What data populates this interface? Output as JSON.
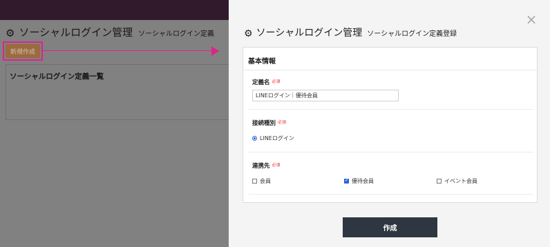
{
  "background": {
    "title": "ソーシャルログイン管理",
    "subtitle": "ソーシャルログイン定義",
    "new_button": "新規作成",
    "list_title": "ソーシャルログイン定義一覧",
    "icon": "gear-icon"
  },
  "annotation": {
    "color": "#e1228b"
  },
  "modal": {
    "title": "ソーシャルログイン管理",
    "subtitle": "ソーシャルログイン定義登録",
    "close_icon": "×",
    "section_title": "基本情報",
    "required_label": "必須",
    "definition_name": {
      "label": "定義名",
      "value": "LINEログイン｜優待会員"
    },
    "connection_type": {
      "label": "接続種別",
      "selected": "LINEログイン"
    },
    "link_destination": {
      "label": "連携先",
      "options": [
        {
          "label": "会員",
          "checked": false
        },
        {
          "label": "優待会員",
          "checked": true
        },
        {
          "label": "イベント会員",
          "checked": false
        }
      ]
    },
    "submit_label": "作成"
  },
  "colors": {
    "header_bg": "#301a2c",
    "submit_bg": "#2e3641",
    "accent": "#2a64d8",
    "required": "#e33333"
  }
}
